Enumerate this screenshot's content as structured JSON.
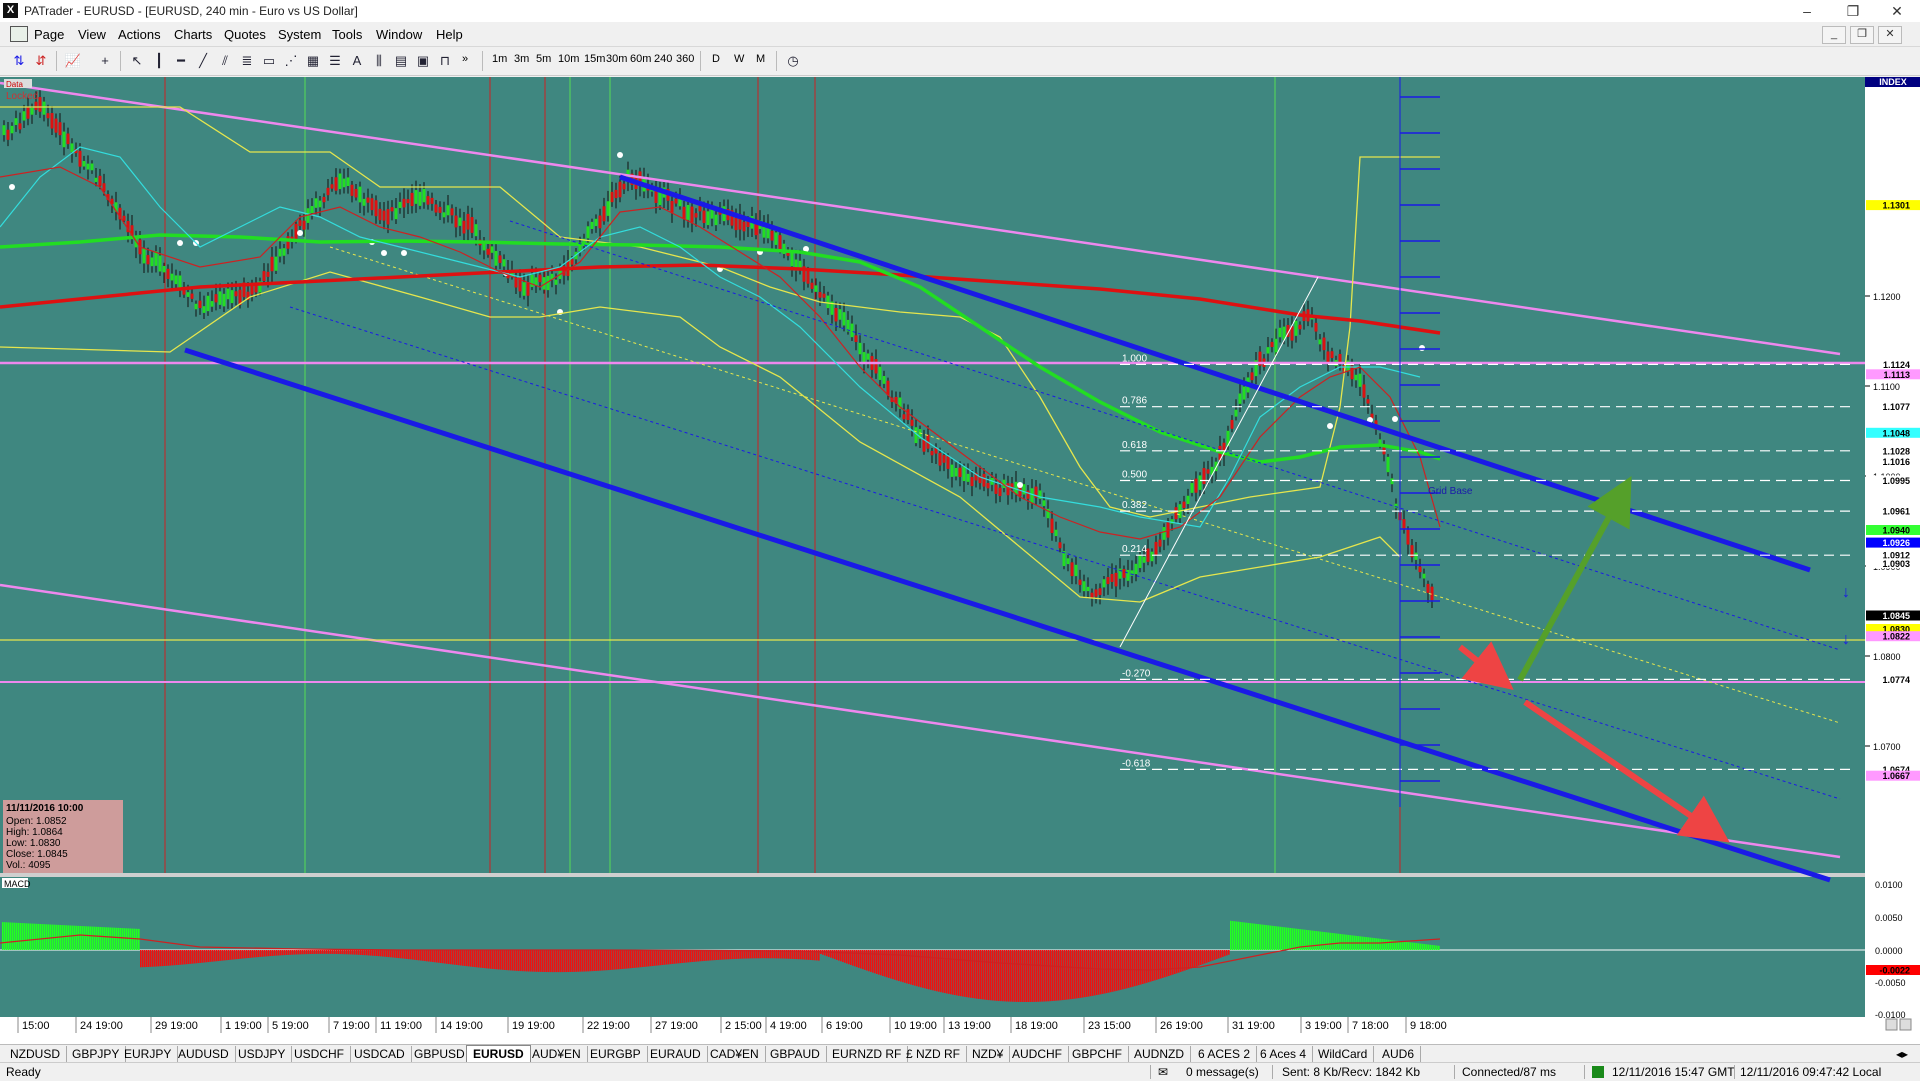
{
  "window": {
    "title": "PATrader - EURUSD - [EURUSD, 240 min - Euro vs US Dollar]",
    "minimize": "–",
    "restore": "❐",
    "close": "✕"
  },
  "menu": {
    "items": [
      "Page",
      "View",
      "Actions",
      "Charts",
      "Quotes",
      "System",
      "Tools",
      "Window",
      "Help"
    ],
    "mdi_min": "_",
    "mdi_restore": "❐",
    "mdi_close": "✕"
  },
  "toolbar": {
    "timeframes": [
      "1m",
      "3m",
      "5m",
      "10m",
      "15m",
      "30m",
      "60m",
      "240",
      "360",
      "D",
      "W",
      "M"
    ],
    "overflow": "»"
  },
  "chart_data": {
    "type": "candlestick",
    "symbol": "EURUSD",
    "timeframe": "240 min",
    "y_ticks": [
      "1.1200",
      "1.1100",
      "1.1000",
      "1.0900",
      "1.0800",
      "1.0700"
    ],
    "y_range": [
      1.062,
      1.131
    ],
    "price_labels": [
      {
        "v": 1.1301,
        "text": "1.1301",
        "bg": "#ffff00",
        "fg": "#000000"
      },
      {
        "v": 1.1124,
        "text": "1.1124",
        "bg": "#ffffff",
        "fg": "#000000"
      },
      {
        "v": 1.1113,
        "text": "1.1113",
        "bg": "#ff99ff",
        "fg": "#000000"
      },
      {
        "v": 1.1077,
        "text": "1.1077",
        "bg": "#ffffff",
        "fg": "#000000"
      },
      {
        "v": 1.1048,
        "text": "1.1048",
        "bg": "#33ffff",
        "fg": "#000000"
      },
      {
        "v": 1.1028,
        "text": "1.1028",
        "bg": "#ffffff",
        "fg": "#000000"
      },
      {
        "v": 1.1016,
        "text": "1.1016",
        "bg": "#ffffff",
        "fg": "#000000"
      },
      {
        "v": 1.0995,
        "text": "1.0995",
        "bg": "#ffffff",
        "fg": "#000000"
      },
      {
        "v": 1.0961,
        "text": "1.0961",
        "bg": "#ffffff",
        "fg": "#000000"
      },
      {
        "v": 1.094,
        "text": "1.0940",
        "bg": "#33ff33",
        "fg": "#000000"
      },
      {
        "v": 1.0926,
        "text": "1.0926",
        "bg": "#0000ff",
        "fg": "#ffffff"
      },
      {
        "v": 1.0912,
        "text": "1.0912",
        "bg": "#ffffff",
        "fg": "#000000"
      },
      {
        "v": 1.0903,
        "text": "1.0903",
        "bg": "#ffffff",
        "fg": "#000000"
      },
      {
        "v": 1.0845,
        "text": "1.0845",
        "bg": "#000000",
        "fg": "#ffffff"
      },
      {
        "v": 1.083,
        "text": "1.0830",
        "bg": "#ffff00",
        "fg": "#000000"
      },
      {
        "v": 1.0822,
        "text": "1.0822",
        "bg": "#ff99ff",
        "fg": "#000000"
      },
      {
        "v": 1.0774,
        "text": "1.0774",
        "bg": "#ffffff",
        "fg": "#000000"
      },
      {
        "v": 1.0674,
        "text": "1.0674",
        "bg": "#ffffff",
        "fg": "#000000"
      },
      {
        "v": 1.0667,
        "text": "1.0667",
        "bg": "#ff99ff",
        "fg": "#000000"
      }
    ],
    "fib_levels": [
      {
        "label": "1.000",
        "v": 1.1124
      },
      {
        "label": "0.786",
        "v": 1.1077
      },
      {
        "label": "0.618",
        "v": 1.1028
      },
      {
        "label": "0.500",
        "v": 1.0995
      },
      {
        "label": "0.382",
        "v": 1.0961
      },
      {
        "label": "0.214",
        "v": 1.0912
      },
      {
        "label": "-0.270",
        "v": 1.0774
      },
      {
        "label": "-0.618",
        "v": 1.0674
      }
    ],
    "time_labels": [
      "15:00",
      "24 19:00",
      "29 19:00",
      "1 19:00",
      "5 19:00",
      "7 19:00",
      "11 19:00",
      "14 19:00",
      "19 19:00",
      "22 19:00",
      "27 19:00",
      "2 15:00",
      "4 19:00",
      "6 19:00",
      "10 19:00",
      "13 19:00",
      "18 19:00",
      "23 15:00",
      "26 19:00",
      "31 19:00",
      "3 19:00",
      "7 18:00",
      "9 18:00"
    ],
    "ohlc_box": {
      "date": "11/11/2016 10:00",
      "open": "Open: 1.0852",
      "high": "High: 1.0864",
      "low": "Low: 1.0830",
      "close": "Close: 1.0845",
      "vol": "Vol.: 4095"
    },
    "labels": {
      "index": "INDEX",
      "locked": "Locked",
      "data": "Data",
      "macd": "MACD",
      "grid_base": "Grid Base"
    },
    "macd_ticks": [
      "0.0100",
      "0.0050",
      "0.0000",
      "-0.0050",
      "-0.0100"
    ],
    "macd_value": {
      "text": "-0.0022",
      "bg": "#ff0000",
      "fg": "#000000"
    },
    "colors": {
      "bg": "#3f8780",
      "channel": "#1a1ae6",
      "pink": "#ee88ee",
      "yellow": "#e6e64d",
      "green": "#22dd22",
      "red": "#dd1111",
      "cyan": "#33dddd"
    }
  },
  "tabs": [
    "NZDUSD",
    "GBPJPY",
    "EURJPY",
    "AUDUSD",
    "USDJPY",
    "USDCHF",
    "USDCAD",
    "GBPUSD",
    "EURUSD",
    "AUD¥EN",
    "EURGBP",
    "EURAUD",
    "CAD¥EN",
    "GBPAUD",
    "EURNZD RF",
    "£ NZD RF",
    "NZD¥",
    "AUDCHF",
    "GBPCHF",
    "AUDNZD",
    "6 ACES 2",
    "6 Aces 4",
    "WildCard",
    "AUD6"
  ],
  "active_tab": "EURUSD",
  "status": {
    "ready": "Ready",
    "messages": "0 message(s)",
    "sent": "Sent: 8 Kb/Recv: 1842 Kb",
    "connected": "Connected/87 ms",
    "gmt": "12/11/2016 15:47 GMT",
    "local": "12/11/2016 09:47:42 Local"
  }
}
